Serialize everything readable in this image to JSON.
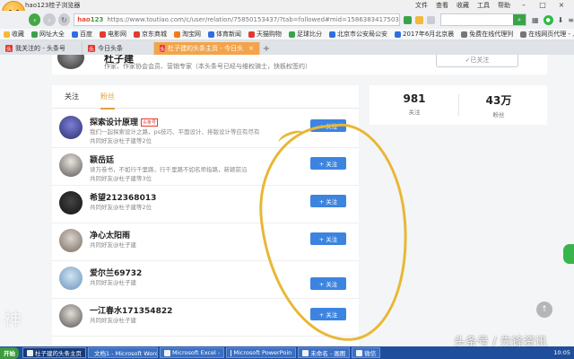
{
  "window": {
    "title": "hao123桂子浏览器",
    "menus": [
      "文件",
      "查看",
      "收藏",
      "工具",
      "帮助"
    ]
  },
  "address": {
    "brand_a": "hao",
    "brand_b": "123",
    "url": "https://www.toutiao.com/c/user/relation/75850153437/?tab=followed#mid=1586383417503757",
    "search_placeholder": ""
  },
  "bookmarks": [
    {
      "label": "收藏",
      "color": "#f4b93a"
    },
    {
      "label": "网址大全",
      "color": "#3aa34a"
    },
    {
      "label": "百度",
      "color": "#2f6ee0"
    },
    {
      "label": "电影网",
      "color": "#e23a30"
    },
    {
      "label": "京东商城",
      "color": "#e23a30"
    },
    {
      "label": "淘宝网",
      "color": "#f07b1d"
    },
    {
      "label": "体育新闻",
      "color": "#2f6ee0"
    },
    {
      "label": "天猫购物",
      "color": "#e23a30"
    },
    {
      "label": "足球比分",
      "color": "#3aa34a"
    },
    {
      "label": "北京市公安局公安",
      "color": "#2f6ee0"
    },
    {
      "label": "2017年6月北京晨",
      "color": "#2f6ee0"
    },
    {
      "label": "免费在线代理列",
      "color": "#777777"
    },
    {
      "label": "在线网页代理 - 人",
      "color": "#777777"
    }
  ],
  "tabs": [
    {
      "label": "我关注的 - 头条号",
      "active": false
    },
    {
      "label": "今日头条",
      "active": false
    },
    {
      "label": "杜子建的头条主页 - 今日头",
      "active": true
    }
  ],
  "profile": {
    "name": "杜子建",
    "desc": "作家、作家协会会员、营销专家（本头条号已经与维权骑士，快板权签约）",
    "followed_label": "✓已关注"
  },
  "subtabs": [
    "关注",
    "粉丝"
  ],
  "users": [
    {
      "name": "探索设计原理",
      "tag": "头条号",
      "line1": "我们一起探索设计之路，ps技巧、平面设计、排版设计等应有尽有",
      "line2": "共同好友@杜子建等2位"
    },
    {
      "name": "颖岳廷",
      "tag": "",
      "line1": "读万卷书，不如行千里路，行千里路不如名师指路，新颖前沿",
      "line2": "共同好友@杜子建等3位"
    },
    {
      "name": "希望212368013",
      "tag": "",
      "line1": "",
      "line2": "共同好友@杜子建等2位"
    },
    {
      "name": "净心太阳雨",
      "tag": "",
      "line1": "",
      "line2": "共同好友@杜子建"
    },
    {
      "name": "爱尔兰69732",
      "tag": "",
      "line1": "",
      "line2": "共同好友@杜子建"
    },
    {
      "name": "一江春水171354822",
      "tag": "",
      "line1": "",
      "line2": "共同好友@杜子建"
    }
  ],
  "follow_label": "+ 关注",
  "stats": [
    {
      "num": "981",
      "label": "关注"
    },
    {
      "num": "43万",
      "label": "粉丝"
    }
  ],
  "taskbar": {
    "start": "开始",
    "tasks": [
      {
        "label": "杜子建的头条主页",
        "active": true
      },
      {
        "label": "文档1 - Microsoft Word",
        "active": false
      },
      {
        "label": "Microsoft Excel -",
        "active": false
      },
      {
        "label": "Microsoft PowerPoin",
        "active": false
      },
      {
        "label": "未命名 - 画图",
        "active": false
      },
      {
        "label": "微信",
        "active": false
      }
    ],
    "time": "10:05"
  },
  "overlay": {
    "left_mark": "神",
    "watermark": "头条号 / 先锋资讯"
  }
}
